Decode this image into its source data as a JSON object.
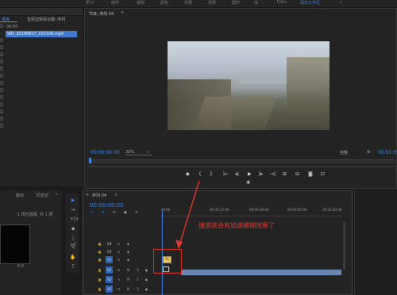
{
  "workspaces": [
    {
      "label": "学习",
      "active": false
    },
    {
      "label": "组件",
      "active": false
    },
    {
      "label": "编辑",
      "active": false
    },
    {
      "label": "颜色",
      "active": false
    },
    {
      "label": "效果",
      "active": false
    },
    {
      "label": "音频",
      "active": false
    },
    {
      "label": "图形",
      "active": false
    },
    {
      "label": "库",
      "active": false
    },
    {
      "label": "Titles",
      "active": false
    },
    {
      "label": "提示工作区",
      "active": true
    }
  ],
  "left_panel": {
    "tab_active": "项目",
    "tab_other": "音频剪辑混合器: 序列",
    "timecode": "00:00",
    "file_name": "VID_20190817_101106.mp4"
  },
  "program_monitor": {
    "title": "节目: 序列 04",
    "timecode": "00:00:00:00",
    "zoom": "20%",
    "quality": "完整",
    "end_timecode": "00:01:0",
    "controls": [
      "◆",
      "{",
      "}",
      "|←",
      "◂|",
      "◂",
      "▶",
      "▸",
      "|▸",
      "→|",
      "⊞",
      "⊟",
      "◙",
      "⊡",
      "✚"
    ]
  },
  "bottom_left": {
    "tab1": "标记",
    "tab2": "历史记",
    "item_count": "1 项已选择, 共 1 项",
    "duration": "0:0"
  },
  "timeline": {
    "title": "序列 04",
    "timecode": "00:00:00:00",
    "ruler": [
      "00:00",
      "00:00:15:00",
      "00:00:30:00",
      "00:00:45:00",
      "00:01:00:00"
    ],
    "tracks": [
      {
        "label": "V3",
        "type": "video"
      },
      {
        "label": "V2",
        "type": "video"
      },
      {
        "label": "V1",
        "type": "video"
      },
      {
        "label": "A1",
        "type": "audio"
      },
      {
        "label": "A2",
        "type": "audio"
      },
      {
        "label": "A3",
        "type": "audio"
      }
    ],
    "annotation": "播放就会有加速模糊效果了"
  },
  "tools": [
    "▶",
    "⇥",
    "+|+",
    "◆",
    "|↔|",
    "✎",
    "✋",
    "T"
  ],
  "colors": {
    "accent": "#3c85e6",
    "annotation": "#e0362c",
    "track_label": "#2b63b8"
  }
}
